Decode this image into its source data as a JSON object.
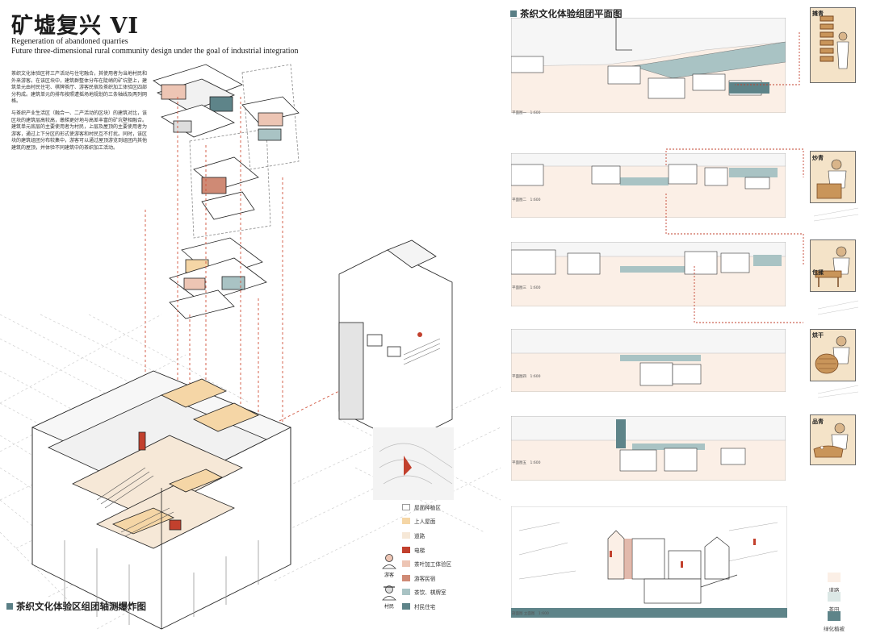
{
  "header": {
    "title": "矿墟复兴 VI",
    "subtitle_line1": "Regeneration of abandoned quarries",
    "subtitle_line2": "Future three-dimensional rural community design under the goal of industrial integration"
  },
  "intro": {
    "paragraph1": "茶织文化体验区将三产活动与住宅融合，其使用者为当地村民和外来游客。在该区块中，建筑群整体分布在陡峭的矿坑壁上，建筑单元由村民住宅、棋牌茶厅、游客民宿及茶织加工体验区四部分构成。建筑单元的排布按照遭摇场地规划的三条轴线及两列网格。",
    "paragraph2": "与茶织产业生活区（融合一、二产活动的区块）的建筑对比，该区块的建筑层高较高，缴梯更好地与高差丰富的矿坑壁相融合。建筑单元底层的主要使用者为村民，上层及屋顶的主要使用者为游客，通过上下分区的形式使游客和村民互不打扰。同时，该区块的建筑组团分布较集中，游客可以通过屋顶游览到组团内其他建筑的屋顶，并体验不同建筑中的茶织加工活动。"
  },
  "left_section": {
    "title": "茶织文化体验区组团轴测爆炸图"
  },
  "legend": {
    "items": [
      {
        "label": "屋面种植区",
        "color": "#ffffff",
        "border": "#9a9a9a"
      },
      {
        "label": "上人屋面",
        "color": "#f5d6a6",
        "border": "#f5d6a6"
      },
      {
        "label": "道路",
        "color": "#f6e8d7",
        "border": "#f6e8d7"
      },
      {
        "label": "电梯",
        "color": "#c2402d",
        "border": "#c2402d"
      },
      {
        "label": "茶叶加工体验区",
        "color": "#edc5b4",
        "border": "#edc5b4"
      },
      {
        "label": "游客民宿",
        "color": "#cf8a75",
        "border": "#cf8a75"
      },
      {
        "label": "茶饮、棋牌室",
        "color": "#a9c3c4",
        "border": "#a9c3c4"
      },
      {
        "label": "村民住宅",
        "color": "#5e8489",
        "border": "#5e8489"
      }
    ]
  },
  "people": {
    "tourist": "游客",
    "villager": "村民"
  },
  "right_section": {
    "title": "茶织文化体验组团平面图"
  },
  "plans": [
    {
      "label": "平面图一　1:600"
    },
    {
      "label": "平面图二　1:600"
    },
    {
      "label": "平面图三　1:600"
    },
    {
      "label": "平面图四　1:600"
    },
    {
      "label": "平面图五　1:600"
    }
  ],
  "section_plan": {
    "label": "剖面图 立面图　1:600"
  },
  "photos": [
    {
      "label": "摊青"
    },
    {
      "label": "炒青"
    },
    {
      "label": "包揉"
    },
    {
      "label": "烘干"
    },
    {
      "label": "品青"
    }
  ],
  "right_legend": {
    "items": [
      {
        "label": "道路",
        "color": "#fbefe6"
      },
      {
        "label": "茶田",
        "color": "#dce8e6"
      },
      {
        "label": "绿化植被",
        "color": "#5e8489"
      }
    ]
  },
  "colors": {
    "accent_teal": "#5e8489",
    "accent_red": "#c2402d",
    "accent_orange": "#f5d6a6",
    "road_pink": "#fbefe6"
  }
}
